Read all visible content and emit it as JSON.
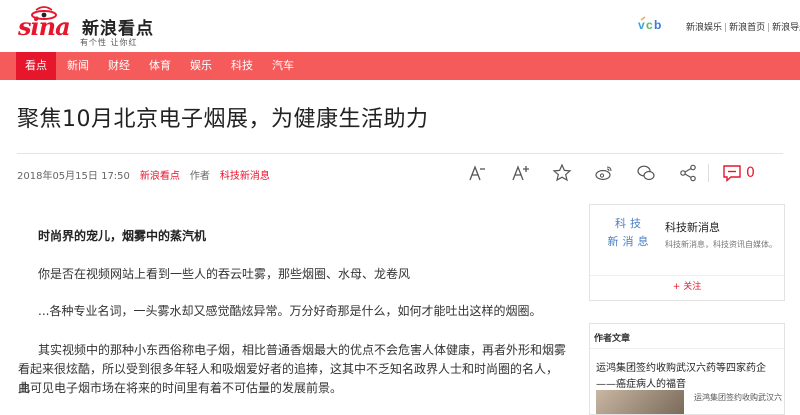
{
  "header": {
    "logo_sina": "sina",
    "logo_brand": "新浪看点",
    "logo_slogan": "有个性 让你红",
    "vcb_icon": "vcb-logo-icon",
    "top_links": [
      "新浪娱乐",
      "新浪首页",
      "新浪导航"
    ],
    "link_separator": "|"
  },
  "nav": {
    "items": [
      {
        "label": "看点",
        "active": true
      },
      {
        "label": "新闻",
        "active": false
      },
      {
        "label": "财经",
        "active": false
      },
      {
        "label": "体育",
        "active": false
      },
      {
        "label": "娱乐",
        "active": false
      },
      {
        "label": "科技",
        "active": false
      },
      {
        "label": "汽车",
        "active": false
      }
    ]
  },
  "article": {
    "title": "聚焦10月北京电子烟展，为健康生活助力",
    "date": "2018年05月15日 17:50",
    "source": "新浪看点",
    "author_label": "作者",
    "author_name": "科技新消息",
    "comment_count": "0",
    "paragraphs": [
      "时尚界的宠儿，烟雾中的蒸汽机",
      "你是否在视频网站上看到一些人的吞云吐雾，那些烟圈、水母、龙卷风",
      "...各种专业名词，一头雾水却又感觉酷炫异常。万分好奇那是什么，如何才能吐出这样的烟圈。",
      "其实视频中的那种小东西俗称电子烟，相比普通香烟最大的优点不会危害人体健康，再者外形和烟雾",
      "看起来很炫酷，所以受到很多年轻人和吸烟爱好者的追捧，这其中不乏知名政界人士和时尚圈的名人，由",
      "此可见电子烟市场在将来的时间里有着不可估量的发展前景。"
    ]
  },
  "toolbar": {
    "icons": [
      "font-decrease-icon",
      "font-increase-icon",
      "favorite-star-icon",
      "weibo-icon",
      "wechat-icon",
      "share-icon",
      "comment-icon"
    ]
  },
  "sidebar": {
    "author_card": {
      "avatar_text_1": "科技",
      "avatar_text_2": "新消息",
      "name": "科技新消息",
      "desc": "科技新消息，科技资讯自媒体。",
      "follow_label": "+ 关注"
    },
    "author_articles": {
      "heading": "作者文章",
      "headline_1": "运鸿集团签约收购武汉六药等四家药企",
      "headline_2": "——癌症病人的福音",
      "sub_headline": "运鸿集团签约收购武汉六"
    }
  },
  "colors": {
    "brand_red": "#e6162d",
    "nav_bg": "#f65b5b",
    "link_blue": "#4a7fc1"
  }
}
